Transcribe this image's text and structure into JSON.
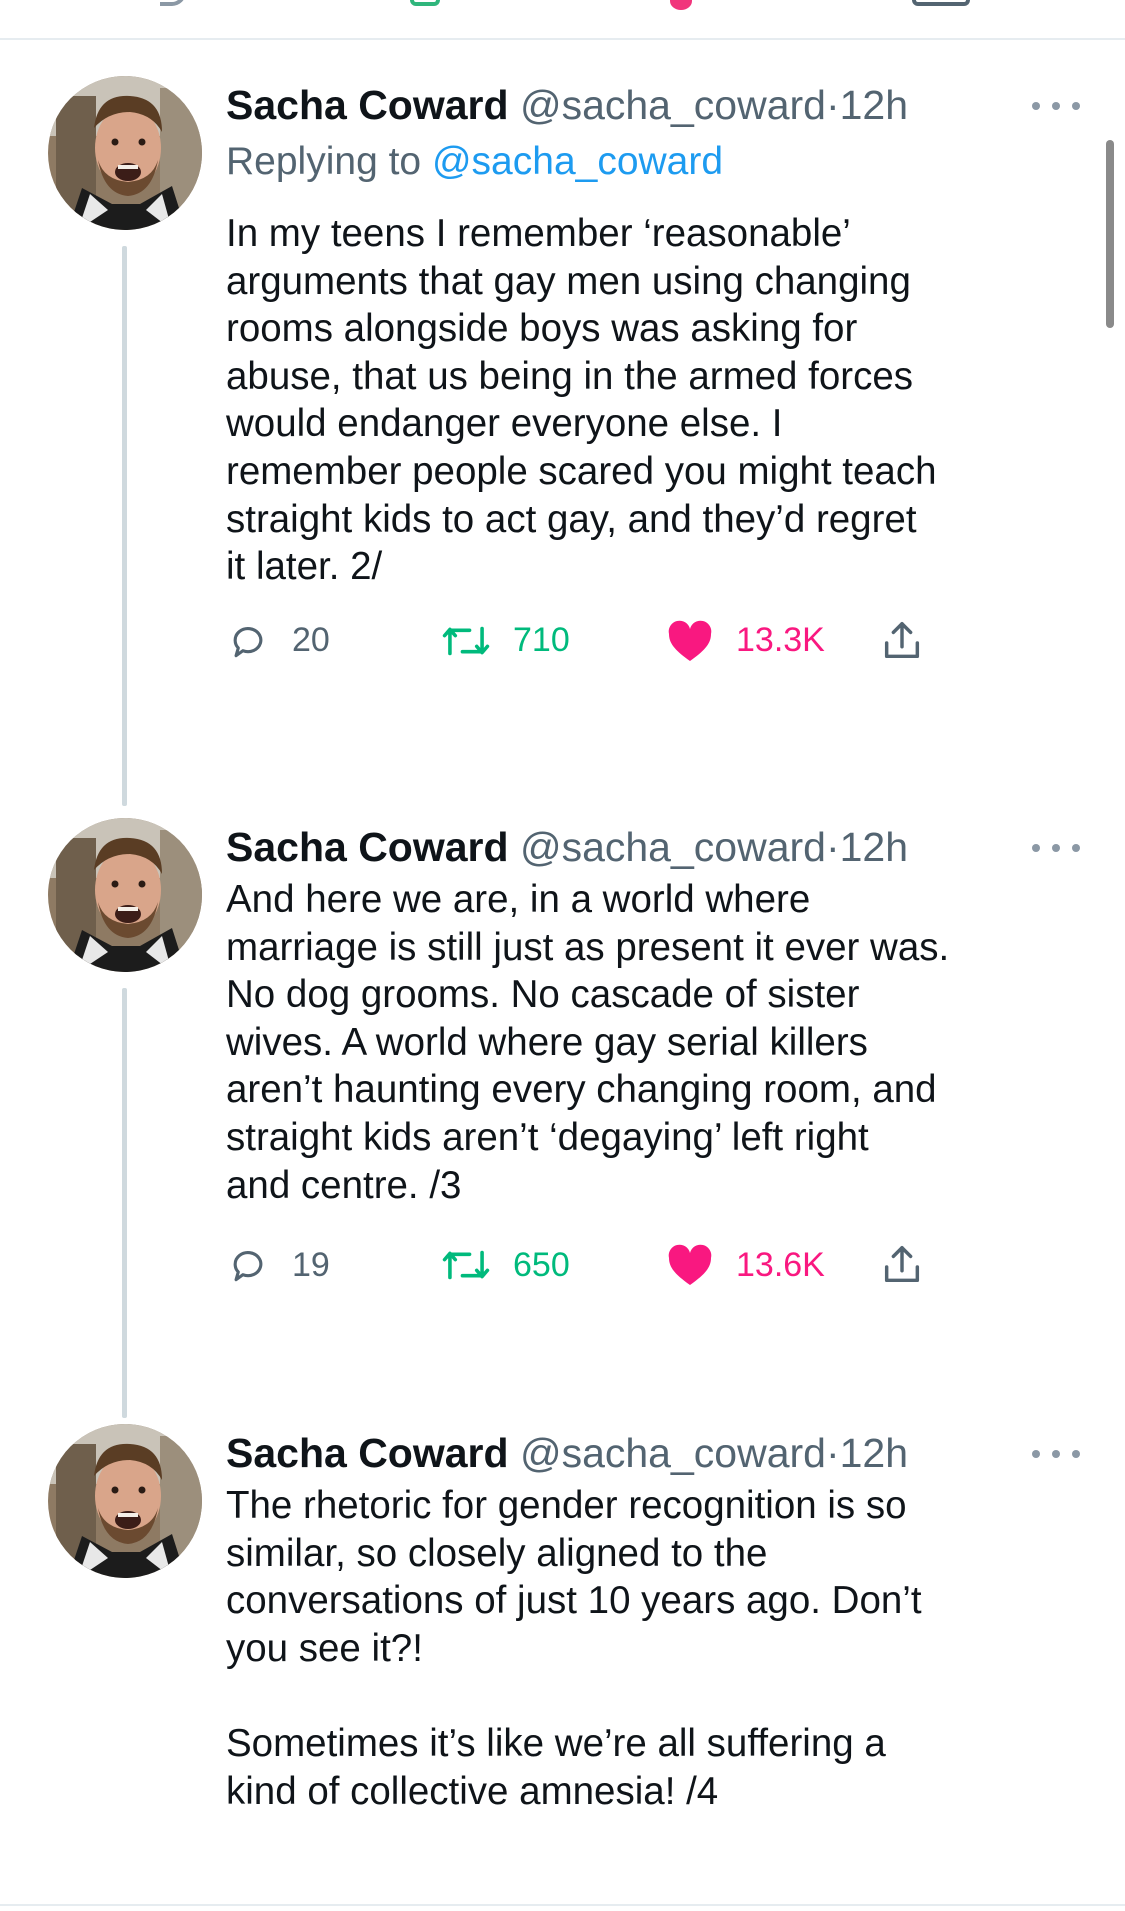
{
  "colors": {
    "handle_gray": "#536471",
    "link_blue": "#1d9bf0",
    "retweet_green": "#00ba7c",
    "like_pink": "#f91880",
    "thread_line": "#cfd9de"
  },
  "tweets": [
    {
      "name": "Sacha Coward",
      "handle": "@sacha_coward",
      "separator": "·",
      "time": "12h",
      "replying_prefix": "Replying to",
      "replying_handle": "@sacha_coward",
      "text": "In my teens I remember ‘reasonable’\narguments that gay men using changing\nrooms alongside boys was asking for\nabuse, that us being in the armed forces\nwould endanger everyone else. I\nremember people scared you might teach\nstraight kids to act gay, and they’d regret\nit later. 2/",
      "replies": "20",
      "retweets": "710",
      "likes": "13.3K",
      "liked": true,
      "icons": [
        "reply-icon",
        "retweet-icon",
        "heart-icon",
        "share-icon",
        "more-icon"
      ]
    },
    {
      "name": "Sacha Coward",
      "handle": "@sacha_coward",
      "separator": "·",
      "time": "12h",
      "text": "And here we are, in a world where\nmarriage is still just as present it ever was.\nNo dog grooms. No cascade of sister\nwives. A world where gay serial killers\naren’t haunting every changing room, and\nstraight kids aren’t ‘degaying’ left right\nand centre. /3",
      "replies": "19",
      "retweets": "650",
      "likes": "13.6K",
      "liked": true,
      "icons": [
        "reply-icon",
        "retweet-icon",
        "heart-icon",
        "share-icon",
        "more-icon"
      ]
    },
    {
      "name": "Sacha Coward",
      "handle": "@sacha_coward",
      "separator": "·",
      "time": "12h",
      "text": "The rhetoric for gender recognition is so\nsimilar, so closely aligned to the\nconversations of just 10 years ago. Don’t\nyou see it?!\n\nSometimes it’s like we’re all suffering a\nkind of collective amnesia! /4",
      "icons": [
        "more-icon"
      ]
    }
  ]
}
